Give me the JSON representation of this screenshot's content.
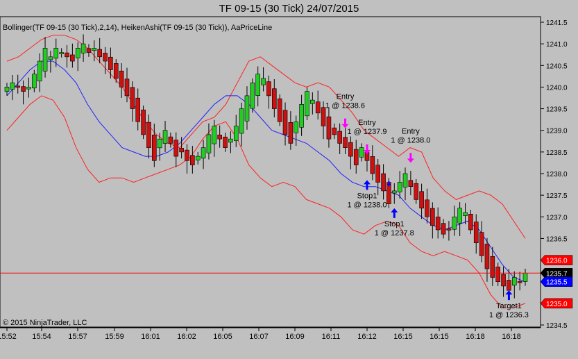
{
  "window": {
    "title": "TF 09-15 (30 Tick)  24/07/2015",
    "indicators_label": "Bollinger(TF 09-15 (30 Tick),2,14), HeikenAshi(TF 09-15 (30 Tick)), AaPriceLine",
    "copyright": "© 2015 NinjaTrader, LLC"
  },
  "colors": {
    "background": "#c0c0c0",
    "up_candle": "#22cc22",
    "down_candle": "#cc1111",
    "bollinger_band": "#ff2020",
    "bollinger_mid": "#2020ff",
    "price_line": "#ff0000",
    "entry_arrow": "#ff00ff",
    "exit_arrow": "#0000ff"
  },
  "chart_data": {
    "type": "candlestick",
    "instrument": "TF 09-15 (30 Tick)",
    "ylim": [
      1234.5,
      1241.5
    ],
    "y_ticks": [
      "1234.5",
      "1235.0",
      "1235.5",
      "1236.0",
      "1236.5",
      "1237.0",
      "1237.5",
      "1238.0",
      "1238.5",
      "1239.0",
      "1239.5",
      "1240.0",
      "1240.5",
      "1241.0",
      "1241.5"
    ],
    "x_ticks": [
      "15:52",
      "15:54",
      "15:57",
      "15:59",
      "16:01",
      "16:02",
      "16:05",
      "16:07",
      "16:09",
      "16:11",
      "16:12",
      "16:15",
      "16:15",
      "16:18",
      "16:18"
    ],
    "closes": [
      1240.0,
      1240.1,
      1240.0,
      1239.9,
      1240.0,
      1240.3,
      1240.6,
      1240.9,
      1240.7,
      1240.9,
      1240.8,
      1240.7,
      1240.6,
      1240.9,
      1241.0,
      1240.8,
      1240.9,
      1240.7,
      1240.6,
      1240.4,
      1240.2,
      1240.0,
      1239.8,
      1239.5,
      1239.2,
      1238.9,
      1238.6,
      1238.3,
      1238.8,
      1239.0,
      1238.7,
      1238.4,
      1238.5,
      1238.3,
      1238.2,
      1238.4,
      1238.6,
      1238.9,
      1239.1,
      1238.8,
      1238.6,
      1238.8,
      1239.1,
      1239.5,
      1239.8,
      1240.1,
      1240.3,
      1240.2,
      1239.8,
      1239.5,
      1239.2,
      1238.9,
      1238.7,
      1239.2,
      1239.6,
      1239.9,
      1239.7,
      1239.4,
      1239.1,
      1238.8,
      1238.9,
      1238.7,
      1238.6,
      1238.4,
      1238.2,
      1238.6,
      1238.3,
      1238.0,
      1237.8,
      1237.6,
      1237.3,
      1237.6,
      1237.8,
      1238.0,
      1237.7,
      1237.4,
      1237.2,
      1237.0,
      1236.8,
      1236.7,
      1236.6,
      1236.7,
      1237.0,
      1237.2,
      1237.1,
      1236.7,
      1236.4,
      1236.1,
      1235.8,
      1235.6,
      1235.5,
      1235.4,
      1235.3,
      1235.6,
      1235.5,
      1235.7
    ],
    "series": [
      {
        "name": "Bollinger upper",
        "values": [
          1240.6,
          1240.7,
          1240.9,
          1241.1,
          1241.2,
          1241.2,
          1241.1,
          1240.9,
          1240.6,
          1240.3,
          1240.0,
          1239.6,
          1239.2,
          1238.9,
          1238.7,
          1238.6,
          1238.9,
          1239.2,
          1239.3,
          1239.6,
          1240.1,
          1240.6,
          1240.7,
          1240.5,
          1240.3,
          1240.1,
          1240.0,
          1240.1,
          1240.0,
          1239.7,
          1239.4,
          1239.0,
          1238.8,
          1238.6,
          1238.4,
          1238.6,
          1238.5,
          1237.9,
          1237.6,
          1237.4,
          1237.5,
          1237.6,
          1237.5,
          1237.3,
          1236.9,
          1236.5
        ]
      },
      {
        "name": "Bollinger middle",
        "values": [
          1239.8,
          1240.1,
          1240.4,
          1240.6,
          1240.6,
          1240.4,
          1240.1,
          1239.6,
          1239.2,
          1238.9,
          1238.6,
          1238.5,
          1238.4,
          1238.4,
          1238.5,
          1238.7,
          1239.0,
          1239.3,
          1239.6,
          1239.8,
          1239.8,
          1239.6,
          1239.3,
          1239.0,
          1238.9,
          1238.8,
          1238.7,
          1238.5,
          1238.3,
          1238.0,
          1237.8,
          1237.7,
          1237.7,
          1237.6,
          1237.5,
          1237.2,
          1237.0,
          1236.8,
          1236.7,
          1236.8,
          1236.9,
          1236.7,
          1236.3,
          1235.9,
          1235.6,
          1235.5
        ]
      },
      {
        "name": "Bollinger lower",
        "values": [
          1239.0,
          1239.3,
          1239.6,
          1239.8,
          1239.7,
          1239.3,
          1238.6,
          1238.1,
          1237.8,
          1237.9,
          1237.9,
          1237.8,
          1237.9,
          1238.0,
          1238.1,
          1238.2,
          1238.4,
          1238.8,
          1239.1,
          1239.2,
          1238.8,
          1238.2,
          1237.9,
          1237.7,
          1237.8,
          1237.7,
          1237.4,
          1237.3,
          1237.2,
          1237.0,
          1236.7,
          1236.6,
          1236.8,
          1236.9,
          1236.8,
          1236.4,
          1236.2,
          1236.1,
          1236.2,
          1236.1,
          1236.0,
          1235.7,
          1235.2,
          1234.9,
          1234.9,
          1235.0
        ]
      }
    ],
    "price_line": 1235.7,
    "price_labels": [
      {
        "text": "1236.0",
        "value": 1236.0,
        "bg": "#ff0000",
        "fg": "#ffffff"
      },
      {
        "text": "1235.7",
        "value": 1235.7,
        "bg": "#000000",
        "fg": "#ffffff"
      },
      {
        "text": "1235.5",
        "value": 1235.5,
        "bg": "#0000ff",
        "fg": "#ffffff"
      },
      {
        "text": "1235.0",
        "value": 1235.0,
        "bg": "#ff0000",
        "fg": "#ffffff"
      }
    ],
    "annotations": [
      {
        "lines": [
          "Entry",
          "1 @ 1238.6"
        ],
        "kind": "entry",
        "bar": 62,
        "price": 1239.05
      },
      {
        "lines": [
          "Entry",
          "1 @ 1237.9"
        ],
        "kind": "entry",
        "bar": 66,
        "price": 1238.45
      },
      {
        "lines": [
          "Entry",
          "1 @ 1238.0"
        ],
        "kind": "entry",
        "bar": 74,
        "price": 1238.25
      },
      {
        "lines": [
          "Stop1",
          "1 @ 1238.0"
        ],
        "kind": "exit",
        "bar": 66,
        "price": 1237.85
      },
      {
        "lines": [
          "Stop1",
          "1 @ 1237.8"
        ],
        "kind": "exit",
        "bar": 71,
        "price": 1237.2
      },
      {
        "lines": [
          "Target1",
          "1 @ 1236.3"
        ],
        "kind": "exit",
        "bar": 92,
        "price": 1235.3
      }
    ],
    "marker_small": {
      "bar": 70,
      "price": 1237.7
    }
  }
}
